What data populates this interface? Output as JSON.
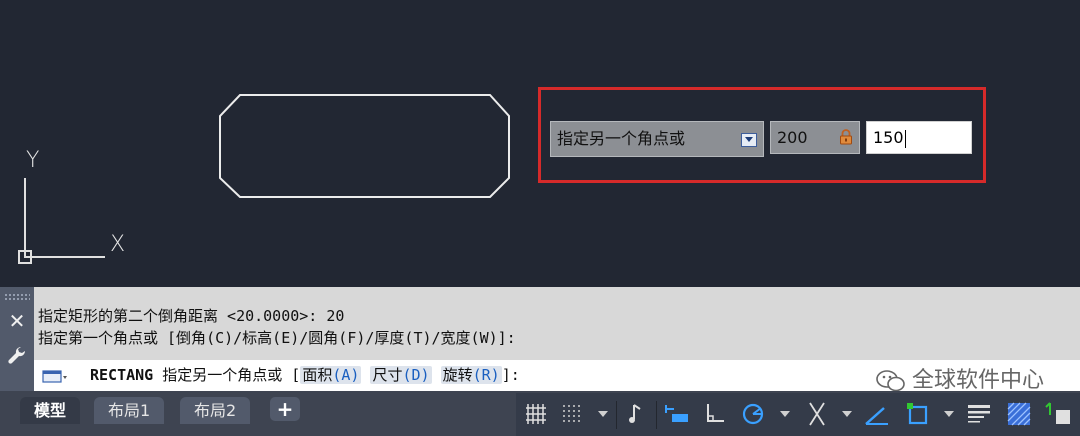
{
  "dynamic_input": {
    "prompt": "指定另一个角点或",
    "field1_value": "200",
    "field2_value": "150"
  },
  "ucs": {
    "y_label": "Y",
    "x_label": "X"
  },
  "command": {
    "history": [
      "指定矩形的第二个倒角距离 <20.0000>: 20",
      "指定第一个角点或 [倒角(C)/标高(E)/圆角(F)/厚度(T)/宽度(W)]:"
    ],
    "current_command": "RECTANG",
    "current_prompt": "指定另一个角点或",
    "options": [
      {
        "label": "面积",
        "key": "(A)"
      },
      {
        "label": "尺寸",
        "key": "(D)"
      },
      {
        "label": "旋转",
        "key": "(R)"
      }
    ],
    "close_label": "✕",
    "open_bracket": "[",
    "close_bracket": "]:"
  },
  "tabs": [
    {
      "label": "模型",
      "active": true
    },
    {
      "label": "布局1",
      "active": false
    },
    {
      "label": "布局2",
      "active": false
    }
  ],
  "add_tab_label": "+",
  "watermark": "全球软件中心",
  "colors": {
    "canvas": "#222733",
    "highlight_frame": "#d62a2a",
    "option_key": "#1a5fc0"
  }
}
